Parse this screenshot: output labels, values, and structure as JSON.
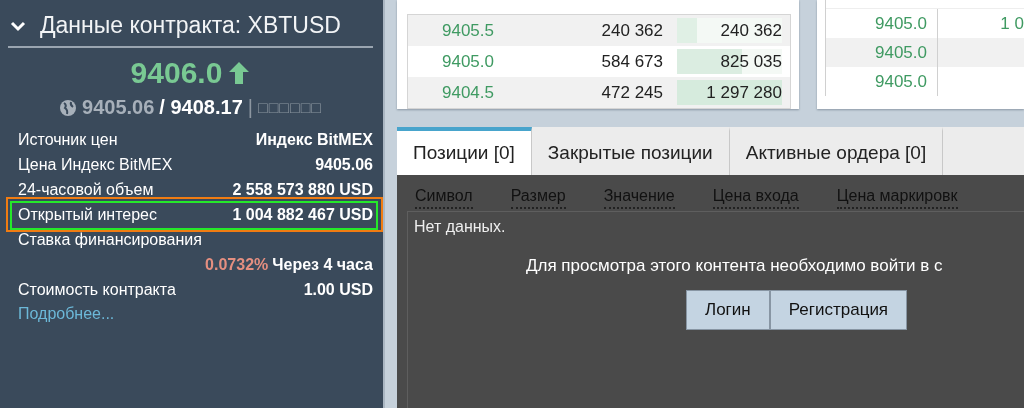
{
  "contract_panel": {
    "title": "Данные контракта: XBTUSD",
    "expanded": true,
    "last_price": "9406.0",
    "index_price": "9405.06",
    "mark_price": "/ 9408.17",
    "separator": "|",
    "placeholder_glyphs": "□□□□□□",
    "rows": [
      {
        "kind": "pair",
        "label": "Источник цен",
        "value": "Индекс BitMEX",
        "highlighted": false
      },
      {
        "kind": "pair",
        "label": "Цена Индекс BitMEX",
        "value": "9405.06",
        "highlighted": false
      },
      {
        "kind": "pair",
        "label": "24-часовой объем",
        "value": "2 558 573 880 USD",
        "highlighted": false
      },
      {
        "kind": "pair",
        "label": "Открытый интерес",
        "value": "1 004 882 467 USD",
        "highlighted": true
      },
      {
        "kind": "funding",
        "label": "Ставка финансирования",
        "rate": "0.0732%",
        "value": "Через 4 часа",
        "highlighted": false
      },
      {
        "kind": "pair",
        "label": "Стоимость контракта",
        "value": "1.00 USD",
        "highlighted": false
      }
    ],
    "more_link": "Подробнее..."
  },
  "order_book": {
    "rows": [
      {
        "price": "9405.5",
        "size": "240 362",
        "total": "240 362",
        "level": 0.19
      },
      {
        "price": "9405.0",
        "size": "584 673",
        "total": "825 035",
        "level": 0.62
      },
      {
        "price": "9404.5",
        "size": "472 245",
        "total": "1 297 280",
        "level": 1.0
      }
    ]
  },
  "recent_trades": {
    "rows": [
      {
        "price": "9405.0",
        "size": "1 0"
      },
      {
        "price": "9405.0",
        "size": ""
      },
      {
        "price": "9405.0",
        "size": ""
      }
    ]
  },
  "positions": {
    "tabs": [
      {
        "label": "Позиции [0]",
        "selected": true
      },
      {
        "label": "Закрытые позиции",
        "selected": false
      },
      {
        "label": "Активные ордера [0]",
        "selected": false
      }
    ],
    "columns": [
      "Символ",
      "Размер",
      "Значение",
      "Цена входа",
      "Цена маркировк"
    ],
    "empty_text": "Нет данных.",
    "message": "Для просмотра этого контента необходимо войти в с",
    "buttons": [
      "Логин",
      "Регистрация"
    ]
  }
}
